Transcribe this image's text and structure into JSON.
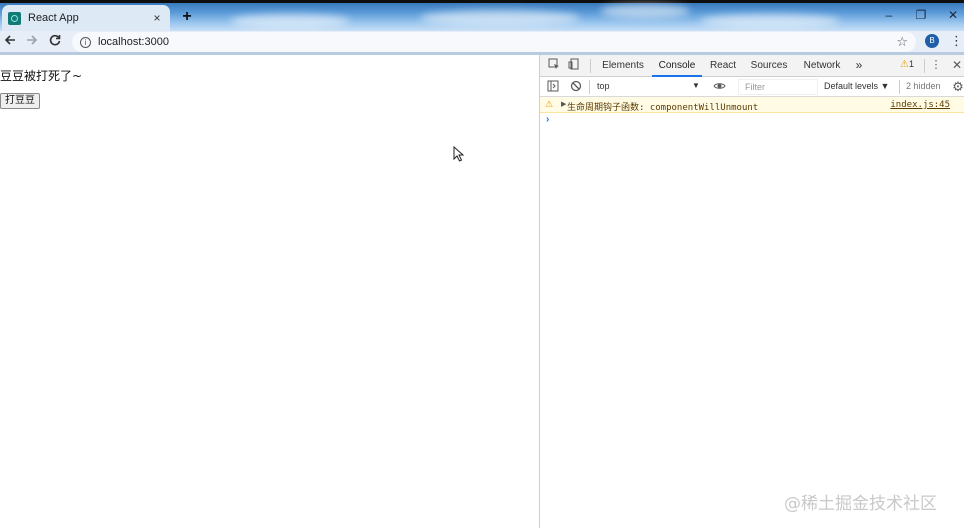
{
  "browser": {
    "tab_title": "React App",
    "tab_close_icon": "×",
    "new_tab_icon": "+",
    "window_controls": {
      "minimize": "–",
      "restore": "❐",
      "close": "✕"
    },
    "url": "localhost:3000",
    "profile_initial": "B"
  },
  "page": {
    "status_text": "豆豆被打死了~",
    "button_label": "打豆豆"
  },
  "devtools": {
    "tabs": [
      "Elements",
      "Console",
      "React",
      "Sources",
      "Network"
    ],
    "active_tab": "Console",
    "more_tabs": "»",
    "warning_count": "1",
    "context": "top",
    "filter_placeholder": "Filter",
    "levels_label": "Default levels ▼",
    "hidden_label": "2 hidden",
    "warning": {
      "label": "生命周期钩子函数:",
      "value": "componentWillUnmount",
      "source": "index.js:45"
    },
    "prompt": "›"
  },
  "watermark": "@稀土掘金技术社区",
  "colors": {
    "accent": "#1a73e8",
    "warning": "#e5a000",
    "warning_bg": "#fffbe5"
  }
}
